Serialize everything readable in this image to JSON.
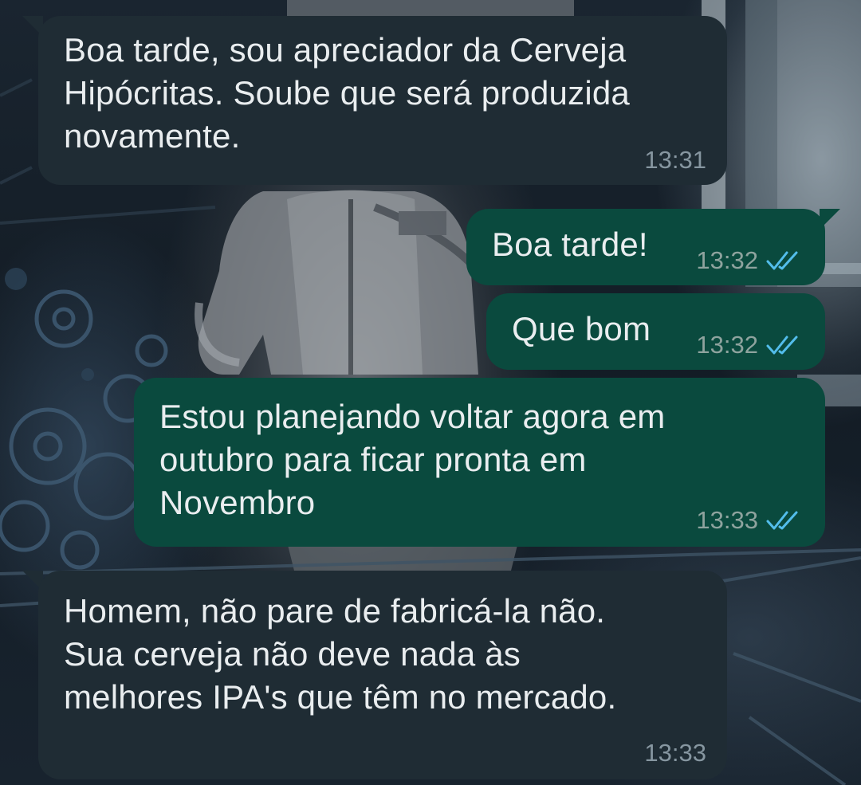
{
  "chat": {
    "messages": [
      {
        "direction": "incoming",
        "text": "Boa tarde, sou apreciador da Cerveja\nHipócritas. Soube que será produzida\nnovamente.",
        "time": "13:31"
      },
      {
        "direction": "outgoing",
        "text": "Boa tarde!",
        "time": "13:32",
        "status": "read",
        "status_icon": "double-check-icon"
      },
      {
        "direction": "outgoing",
        "text": "Que bom",
        "time": "13:32",
        "status": "read",
        "status_icon": "double-check-icon"
      },
      {
        "direction": "outgoing",
        "text": "Estou planejando voltar agora em\noutubro para ficar pronta em\nNovembro",
        "time": "13:33",
        "status": "read",
        "status_icon": "double-check-icon"
      },
      {
        "direction": "incoming",
        "text": "Homem, não pare de fabricá-la não.\nSua cerveja não deve nada às\nmelhores IPA's que têm no mercado.",
        "time": "13:33"
      }
    ]
  },
  "colors": {
    "incoming_bubble": "#1f2c34",
    "outgoing_bubble": "#0a4a3e",
    "message_text": "#e9edef",
    "timestamp": "#8696a0",
    "read_ticks": "#53bdeb"
  }
}
